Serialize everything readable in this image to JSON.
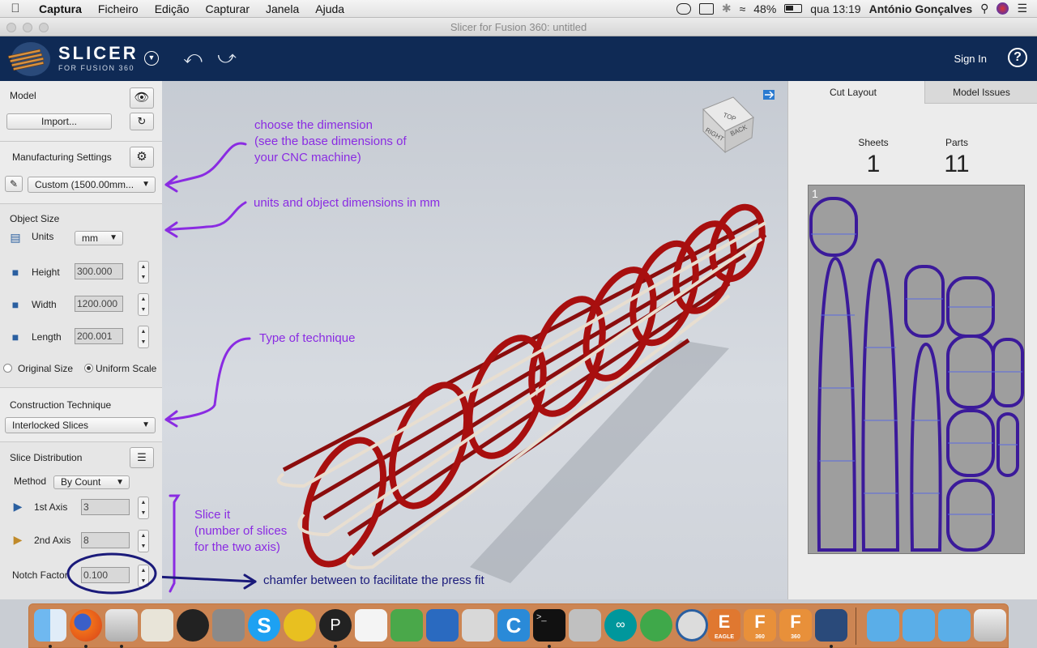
{
  "menubar": {
    "app": "Captura",
    "items": [
      "Ficheiro",
      "Edição",
      "Capturar",
      "Janela",
      "Ajuda"
    ],
    "battery": "48%",
    "clock": "qua 13:19",
    "user": "António Gonçalves"
  },
  "window": {
    "title": "Slicer for Fusion 360: untitled"
  },
  "header": {
    "logo_title": "SLICER",
    "logo_sub": "FOR FUSION 360",
    "signin": "Sign In",
    "help": "?"
  },
  "model": {
    "label": "Model",
    "import_label": "Import..."
  },
  "manufacturing": {
    "label": "Manufacturing Settings",
    "selected": "Custom (1500.00mm..."
  },
  "object_size": {
    "label": "Object Size",
    "units_label": "Units",
    "units_value": "mm",
    "height_label": "Height",
    "height_value": "300.000",
    "width_label": "Width",
    "width_value": "1200.000",
    "length_label": "Length",
    "length_value": "200.001",
    "original_size": "Original Size",
    "uniform_scale": "Uniform Scale"
  },
  "construction": {
    "label": "Construction Technique",
    "selected": "Interlocked Slices"
  },
  "slice": {
    "label": "Slice Distribution",
    "method_label": "Method",
    "method_value": "By Count",
    "axis1_label": "1st Axis",
    "axis1_value": "3",
    "axis2_label": "2nd Axis",
    "axis2_value": "8",
    "notch_label": "Notch Factor",
    "notch_value": "0.100"
  },
  "annotations": {
    "a1_l1": "choose the dimension",
    "a1_l2": "(see the base dimensions of",
    "a1_l3": "your CNC machine)",
    "a2": "units and object dimensions in mm",
    "a3": "Type of technique",
    "a4_l1": "Slice it",
    "a4_l2": "(number of slices",
    "a4_l3": "for the two axis)",
    "a5": "chamfer between to facilitate the press fit"
  },
  "viewcube": {
    "top": "TOP",
    "right": "RIGHT",
    "back": "BACK"
  },
  "right_panel": {
    "tab_cut": "Cut Layout",
    "tab_issues": "Model Issues",
    "sheets_label": "Sheets",
    "sheets_value": "1",
    "parts_label": "Parts",
    "parts_value": "11",
    "sheet_number": "1"
  },
  "dock": {
    "labels": {
      "eagle": "EAGLE",
      "f360a": "360",
      "f360b": "360"
    }
  },
  "colors": {
    "header_bg": "#0f2a55",
    "annotation": "#8a2be2",
    "annotation_dark": "#1a1a7a",
    "slice_red": "#a01010",
    "part_outline": "#3b1a9a"
  }
}
